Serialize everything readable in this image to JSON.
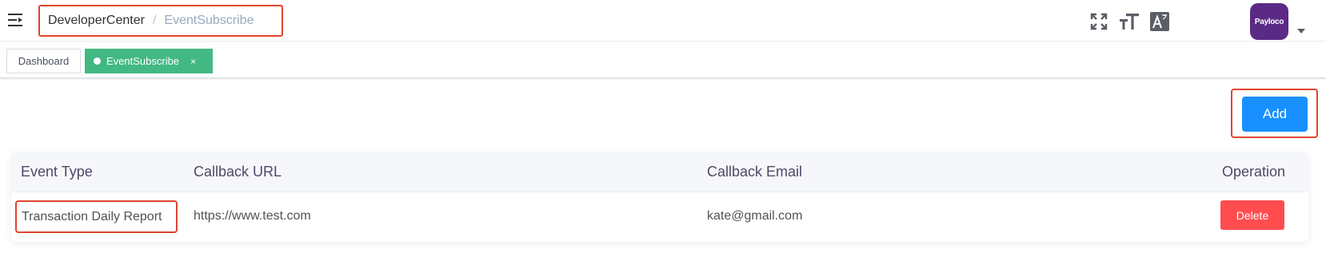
{
  "navbar": {
    "icons": [
      "hamburger-menu-icon",
      "fullscreen-icon",
      "font-size-icon",
      "translate-icon"
    ],
    "breadcrumb": {
      "root": "DeveloperCenter",
      "separator": "/",
      "current": "EventSubscribe"
    },
    "avatar": {
      "text": "Payloco",
      "color": "#5b2a86"
    }
  },
  "tags": {
    "items": [
      {
        "label": "Dashboard",
        "active": false
      },
      {
        "label": "EventSubscribe",
        "active": true,
        "close": "×"
      }
    ],
    "active_color": "#42b983"
  },
  "toolbar": {
    "add_label": "Add",
    "accent": "#1890ff"
  },
  "table": {
    "columns": [
      "Event Type",
      "Callback URL",
      "Callback Email",
      "Operation"
    ],
    "rows": [
      {
        "event_type": "Transaction Daily Report",
        "callback_url": "https://www.test.com",
        "callback_email": "kate@gmail.com",
        "operation": "Delete"
      }
    ],
    "delete_color": "#ff4d4f"
  },
  "highlight_color": "#e0442f"
}
